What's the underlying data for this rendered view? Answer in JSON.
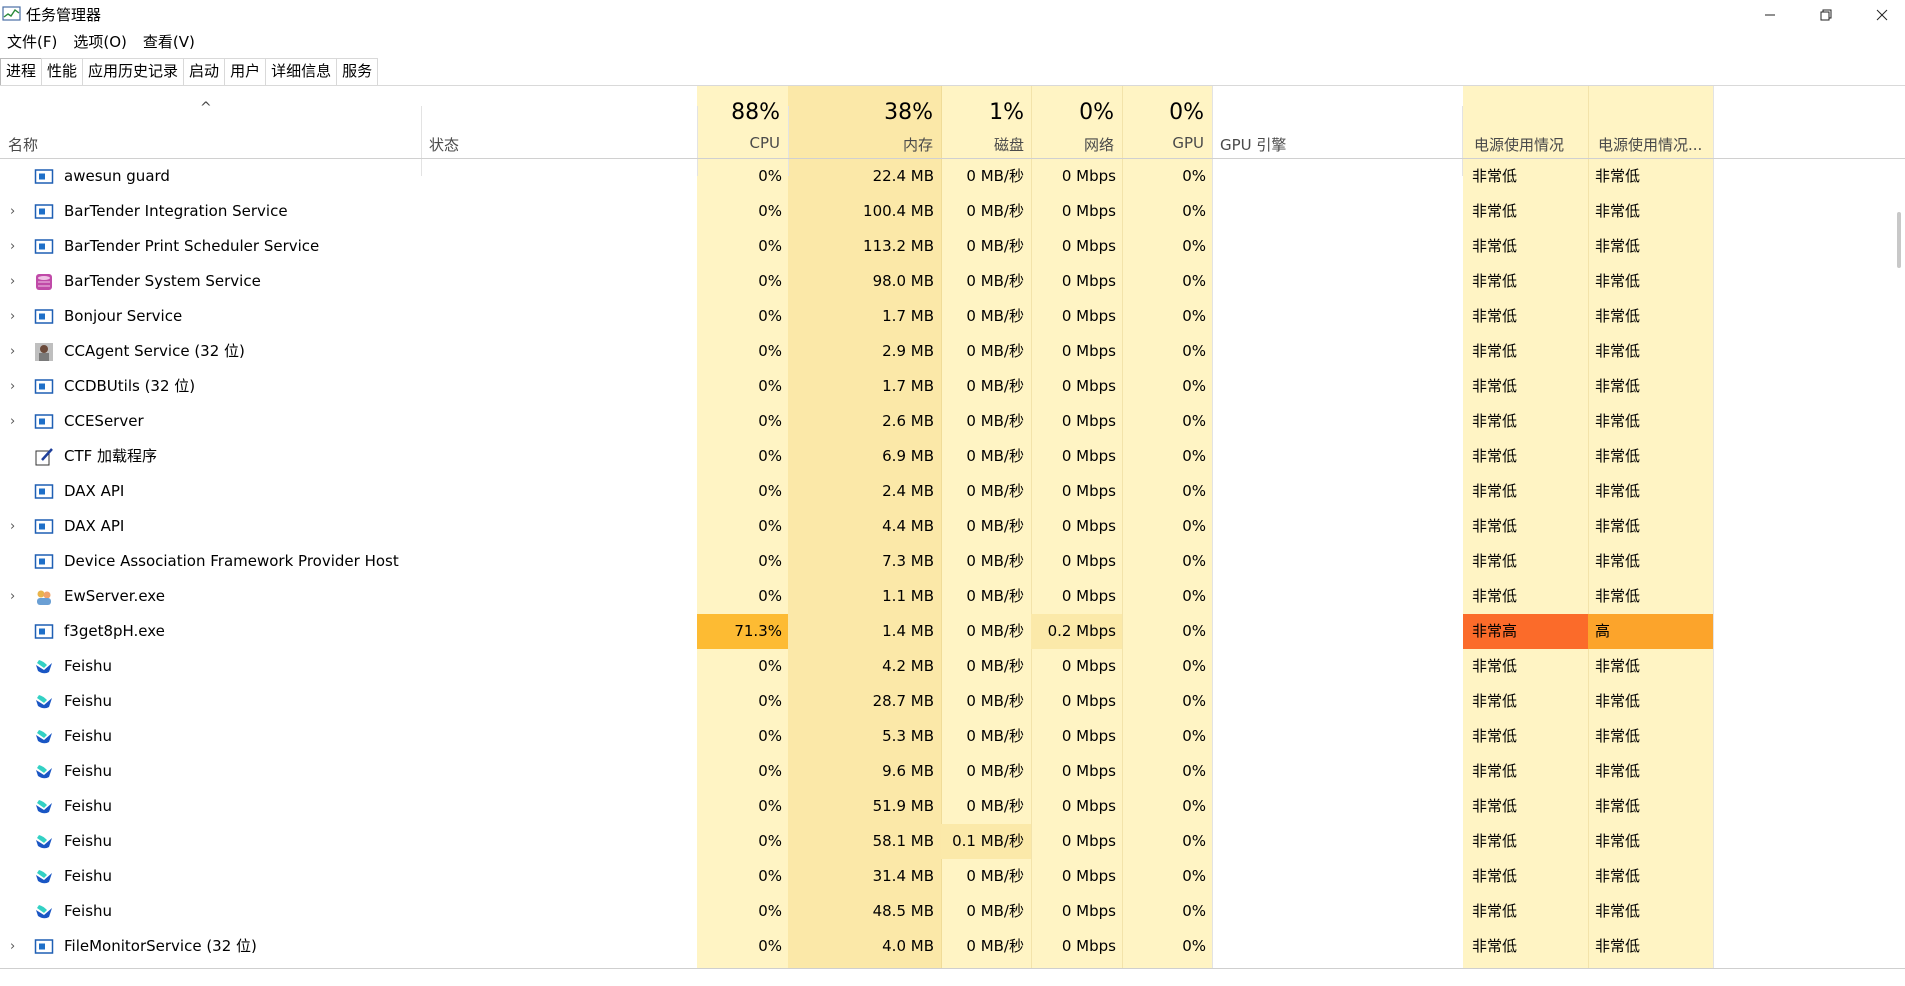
{
  "app": {
    "title": "任务管理器"
  },
  "menu": [
    "文件(F)",
    "选项(O)",
    "查看(V)"
  ],
  "tabs": [
    "进程",
    "性能",
    "应用历史记录",
    "启动",
    "用户",
    "详细信息",
    "服务"
  ],
  "active_tab": 0,
  "columns": {
    "name": "名称",
    "status": "状态",
    "cpu": {
      "pct": "88%",
      "label": "CPU"
    },
    "memory": {
      "pct": "38%",
      "label": "内存"
    },
    "disk": {
      "pct": "1%",
      "label": "磁盘"
    },
    "network": {
      "pct": "0%",
      "label": "网络"
    },
    "gpu": {
      "pct": "0%",
      "label": "GPU"
    },
    "gpu_engine": "GPU 引擎",
    "power": "电源使用情况",
    "power_trend": "电源使用情况..."
  },
  "colors": {
    "col_light": "#fff4c4",
    "col_mem": "#fbe8a8",
    "cpu_high": "#fdbb33",
    "power_very_high": "#fb6b2a",
    "power_high": "#fca42b"
  },
  "processes": [
    {
      "name": "awesun guard",
      "icon": "service-icon",
      "expandable": false,
      "cpu": "0%",
      "mem": "22.4 MB",
      "disk": "0 MB/秒",
      "net": "0 Mbps",
      "gpu": "0%",
      "power": "非常低",
      "power_trend": "非常低"
    },
    {
      "name": "BarTender Integration Service",
      "icon": "service-icon",
      "expandable": true,
      "cpu": "0%",
      "mem": "100.4 MB",
      "disk": "0 MB/秒",
      "net": "0 Mbps",
      "gpu": "0%",
      "power": "非常低",
      "power_trend": "非常低"
    },
    {
      "name": "BarTender Print Scheduler Service",
      "icon": "service-icon",
      "expandable": true,
      "cpu": "0%",
      "mem": "113.2 MB",
      "disk": "0 MB/秒",
      "net": "0 Mbps",
      "gpu": "0%",
      "power": "非常低",
      "power_trend": "非常低"
    },
    {
      "name": "BarTender System Service",
      "icon": "database-icon",
      "expandable": true,
      "cpu": "0%",
      "mem": "98.0 MB",
      "disk": "0 MB/秒",
      "net": "0 Mbps",
      "gpu": "0%",
      "power": "非常低",
      "power_trend": "非常低"
    },
    {
      "name": "Bonjour Service",
      "icon": "service-icon",
      "expandable": true,
      "cpu": "0%",
      "mem": "1.7 MB",
      "disk": "0 MB/秒",
      "net": "0 Mbps",
      "gpu": "0%",
      "power": "非常低",
      "power_trend": "非常低"
    },
    {
      "name": "CCAgent Service (32 位)",
      "icon": "agent-icon",
      "expandable": true,
      "cpu": "0%",
      "mem": "2.9 MB",
      "disk": "0 MB/秒",
      "net": "0 Mbps",
      "gpu": "0%",
      "power": "非常低",
      "power_trend": "非常低"
    },
    {
      "name": "CCDBUtils (32 位)",
      "icon": "service-icon",
      "expandable": true,
      "cpu": "0%",
      "mem": "1.7 MB",
      "disk": "0 MB/秒",
      "net": "0 Mbps",
      "gpu": "0%",
      "power": "非常低",
      "power_trend": "非常低"
    },
    {
      "name": "CCEServer",
      "icon": "service-icon",
      "expandable": true,
      "cpu": "0%",
      "mem": "2.6 MB",
      "disk": "0 MB/秒",
      "net": "0 Mbps",
      "gpu": "0%",
      "power": "非常低",
      "power_trend": "非常低"
    },
    {
      "name": "CTF 加载程序",
      "icon": "pen-icon",
      "expandable": false,
      "cpu": "0%",
      "mem": "6.9 MB",
      "disk": "0 MB/秒",
      "net": "0 Mbps",
      "gpu": "0%",
      "power": "非常低",
      "power_trend": "非常低"
    },
    {
      "name": "DAX API",
      "icon": "service-icon",
      "expandable": false,
      "cpu": "0%",
      "mem": "2.4 MB",
      "disk": "0 MB/秒",
      "net": "0 Mbps",
      "gpu": "0%",
      "power": "非常低",
      "power_trend": "非常低"
    },
    {
      "name": "DAX API",
      "icon": "service-icon",
      "expandable": true,
      "cpu": "0%",
      "mem": "4.4 MB",
      "disk": "0 MB/秒",
      "net": "0 Mbps",
      "gpu": "0%",
      "power": "非常低",
      "power_trend": "非常低"
    },
    {
      "name": "Device Association Framework Provider Host",
      "icon": "service-icon",
      "expandable": false,
      "cpu": "0%",
      "mem": "7.3 MB",
      "disk": "0 MB/秒",
      "net": "0 Mbps",
      "gpu": "0%",
      "power": "非常低",
      "power_trend": "非常低"
    },
    {
      "name": "EwServer.exe",
      "icon": "users-icon",
      "expandable": true,
      "cpu": "0%",
      "mem": "1.1 MB",
      "disk": "0 MB/秒",
      "net": "0 Mbps",
      "gpu": "0%",
      "power": "非常低",
      "power_trend": "非常低"
    },
    {
      "name": "f3get8pH.exe",
      "icon": "service-icon",
      "expandable": false,
      "cpu": "71.3%",
      "mem": "1.4 MB",
      "disk": "0 MB/秒",
      "net": "0.2 Mbps",
      "gpu": "0%",
      "power": "非常高",
      "power_trend": "高",
      "highlight": "cpu-power"
    },
    {
      "name": "Feishu",
      "icon": "feishu-icon",
      "expandable": false,
      "cpu": "0%",
      "mem": "4.2 MB",
      "disk": "0 MB/秒",
      "net": "0 Mbps",
      "gpu": "0%",
      "power": "非常低",
      "power_trend": "非常低"
    },
    {
      "name": "Feishu",
      "icon": "feishu-icon",
      "expandable": false,
      "cpu": "0%",
      "mem": "28.7 MB",
      "disk": "0 MB/秒",
      "net": "0 Mbps",
      "gpu": "0%",
      "power": "非常低",
      "power_trend": "非常低"
    },
    {
      "name": "Feishu",
      "icon": "feishu-icon",
      "expandable": false,
      "cpu": "0%",
      "mem": "5.3 MB",
      "disk": "0 MB/秒",
      "net": "0 Mbps",
      "gpu": "0%",
      "power": "非常低",
      "power_trend": "非常低"
    },
    {
      "name": "Feishu",
      "icon": "feishu-icon",
      "expandable": false,
      "cpu": "0%",
      "mem": "9.6 MB",
      "disk": "0 MB/秒",
      "net": "0 Mbps",
      "gpu": "0%",
      "power": "非常低",
      "power_trend": "非常低"
    },
    {
      "name": "Feishu",
      "icon": "feishu-icon",
      "expandable": false,
      "cpu": "0%",
      "mem": "51.9 MB",
      "disk": "0 MB/秒",
      "net": "0 Mbps",
      "gpu": "0%",
      "power": "非常低",
      "power_trend": "非常低"
    },
    {
      "name": "Feishu",
      "icon": "feishu-icon",
      "expandable": false,
      "cpu": "0%",
      "mem": "58.1 MB",
      "disk": "0.1 MB/秒",
      "net": "0 Mbps",
      "gpu": "0%",
      "power": "非常低",
      "power_trend": "非常低",
      "highlight": "disk"
    },
    {
      "name": "Feishu",
      "icon": "feishu-icon",
      "expandable": false,
      "cpu": "0%",
      "mem": "31.4 MB",
      "disk": "0 MB/秒",
      "net": "0 Mbps",
      "gpu": "0%",
      "power": "非常低",
      "power_trend": "非常低"
    },
    {
      "name": "Feishu",
      "icon": "feishu-icon",
      "expandable": false,
      "cpu": "0%",
      "mem": "48.5 MB",
      "disk": "0 MB/秒",
      "net": "0 Mbps",
      "gpu": "0%",
      "power": "非常低",
      "power_trend": "非常低"
    },
    {
      "name": "FileMonitorService (32 位)",
      "icon": "service-icon",
      "expandable": true,
      "cpu": "0%",
      "mem": "4.0 MB",
      "disk": "0 MB/秒",
      "net": "0 Mbps",
      "gpu": "0%",
      "power": "非常低",
      "power_trend": "非常低"
    }
  ]
}
